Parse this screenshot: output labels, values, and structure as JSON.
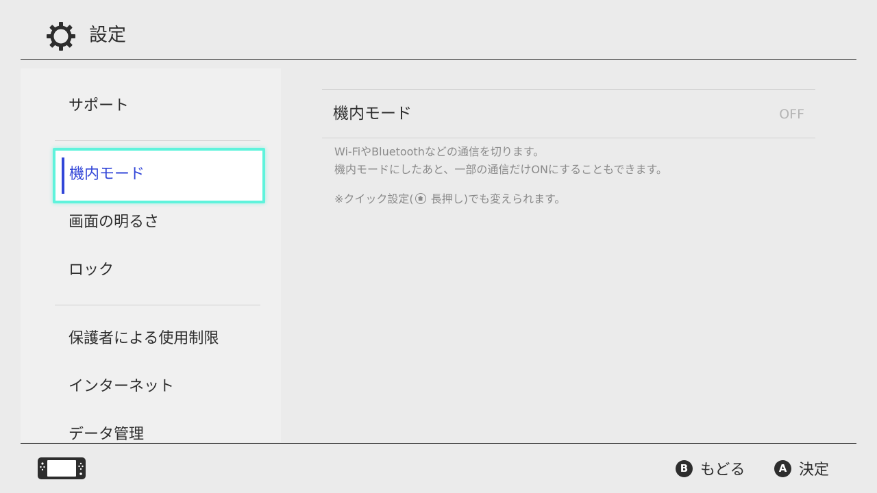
{
  "header": {
    "title": "設定",
    "icon": "gear-icon"
  },
  "sidebar": {
    "items": [
      {
        "label": "サポート"
      },
      {
        "label": "機内モード",
        "selected": true
      },
      {
        "label": "画面の明るさ"
      },
      {
        "label": "ロック"
      },
      {
        "label": "保護者による使用制限"
      },
      {
        "label": "インターネット"
      },
      {
        "label": "データ管理"
      }
    ]
  },
  "main": {
    "setting_label": "機内モード",
    "setting_value": "OFF",
    "description_line1": "Wi-FiやBluetoothなどの通信を切ります。",
    "description_line2": "機内モードにしたあと、一部の通信だけONにすることもできます。",
    "note_prefix": "※クイック設定(",
    "note_suffix": "長押し)でも変えられます。",
    "note_icon": "home-button-icon"
  },
  "footer": {
    "device_icon": "handheld-console-icon",
    "back_glyph": "B",
    "back_label": "もどる",
    "confirm_glyph": "A",
    "confirm_label": "決定"
  },
  "colors": {
    "background": "#ebebeb",
    "sidebar_background": "#f0f0f0",
    "selection_outline": "#5ff3dc",
    "selection_text": "#3246d8",
    "text": "#2d2d2d",
    "muted_text": "#8a8a8a",
    "value_text": "#b4b4b4"
  }
}
